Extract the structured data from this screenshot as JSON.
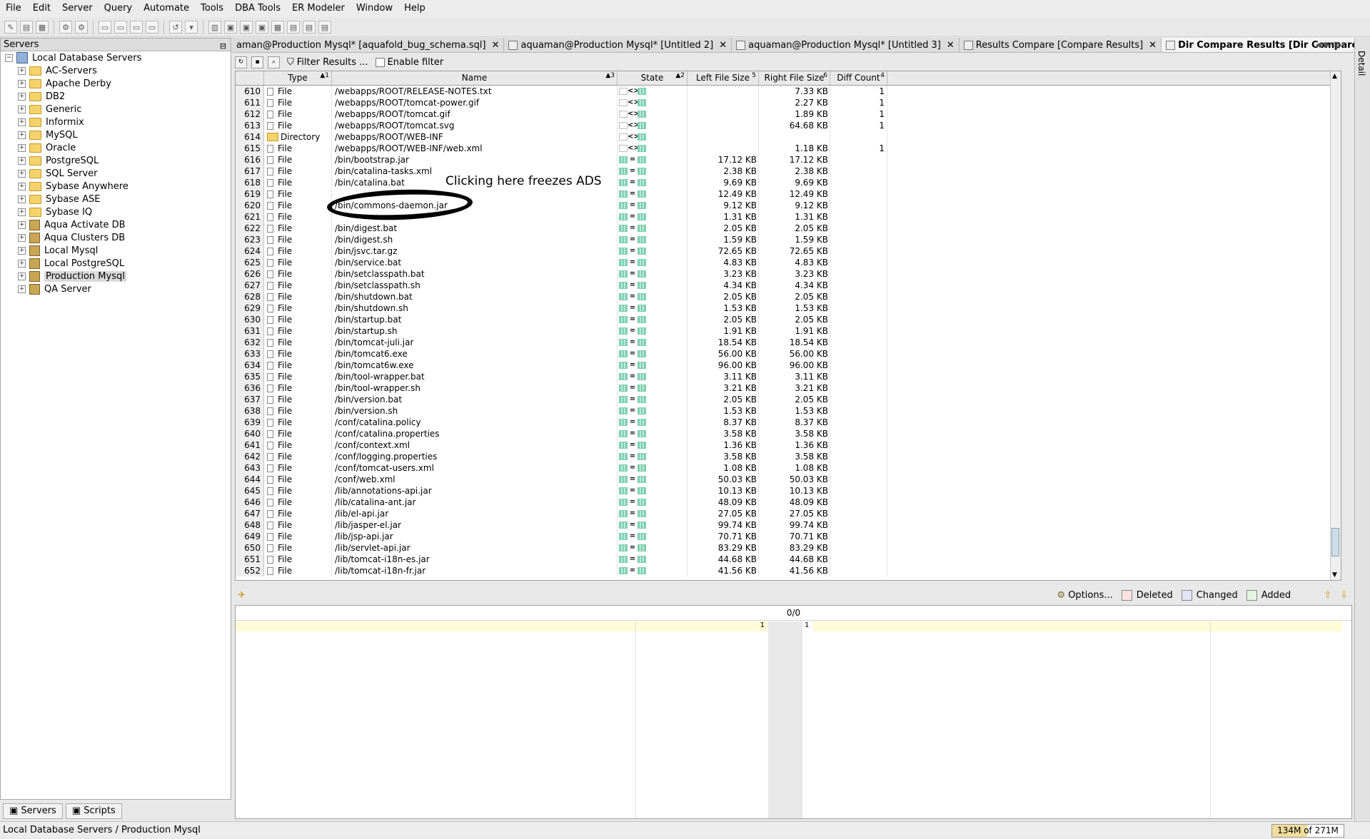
{
  "menu": [
    "File",
    "Edit",
    "Server",
    "Query",
    "Automate",
    "Tools",
    "DBA Tools",
    "ER Modeler",
    "Window",
    "Help"
  ],
  "servers_panel": {
    "title": "Servers",
    "root": "Local Database Servers",
    "items": [
      {
        "label": "AC-Servers",
        "icon": "folder-icon"
      },
      {
        "label": "Apache Derby",
        "icon": "folder-icon"
      },
      {
        "label": "DB2",
        "icon": "folder-icon"
      },
      {
        "label": "Generic",
        "icon": "folder-icon"
      },
      {
        "label": "Informix",
        "icon": "folder-icon"
      },
      {
        "label": "MySQL",
        "icon": "folder-icon"
      },
      {
        "label": "Oracle",
        "icon": "folder-icon"
      },
      {
        "label": "PostgreSQL",
        "icon": "folder-icon"
      },
      {
        "label": "SQL Server",
        "icon": "folder-icon"
      },
      {
        "label": "Sybase Anywhere",
        "icon": "folder-icon"
      },
      {
        "label": "Sybase ASE",
        "icon": "folder-icon"
      },
      {
        "label": "Sybase IQ",
        "icon": "folder-icon"
      },
      {
        "label": "Aqua Activate DB",
        "icon": "database-server-icon"
      },
      {
        "label": "Aqua Clusters DB",
        "icon": "database-server-icon"
      },
      {
        "label": "Local Mysql",
        "icon": "database-server-icon"
      },
      {
        "label": "Local PostgreSQL",
        "icon": "database-server-icon"
      },
      {
        "label": "Production Mysql",
        "icon": "database-server-icon",
        "selected": true
      },
      {
        "label": "QA Server",
        "icon": "database-server-icon"
      }
    ],
    "bottom_tabs": [
      "Servers",
      "Scripts"
    ]
  },
  "doc_tabs": [
    {
      "label": "aman@Production Mysql* [aquafold_bug_schema.sql]",
      "active": false
    },
    {
      "label": "aquaman@Production Mysql* [Untitled 2]",
      "active": false
    },
    {
      "label": "aquaman@Production Mysql* [Untitled 3]",
      "active": false
    },
    {
      "label": "Results Compare [Compare Results]",
      "active": false
    },
    {
      "label": "Dir Compare Results [Dir Compare Results]",
      "active": true
    }
  ],
  "right_strip_label": "Detail",
  "filter_bar": {
    "filter_label": "Filter Results ...",
    "enable_filter_label": "Enable filter"
  },
  "grid": {
    "headers": [
      {
        "label": "",
        "sort": ""
      },
      {
        "label": "Type",
        "sort": "▲1"
      },
      {
        "label": "Name",
        "sort": "▲3"
      },
      {
        "label": "State",
        "sort": "▲2"
      },
      {
        "label": "Left File Size",
        "sort": "5"
      },
      {
        "label": "Right File Size",
        "sort": "6"
      },
      {
        "label": "Diff Count",
        "sort": "4"
      }
    ],
    "rows": [
      [
        "610",
        "File",
        "/webapps/ROOT/RELEASE-NOTES.txt",
        "diff",
        "",
        "7.33 KB",
        "1"
      ],
      [
        "611",
        "File",
        "/webapps/ROOT/tomcat-power.gif",
        "diff",
        "",
        "2.27 KB",
        "1"
      ],
      [
        "612",
        "File",
        "/webapps/ROOT/tomcat.gif",
        "diff",
        "",
        "1.89 KB",
        "1"
      ],
      [
        "613",
        "File",
        "/webapps/ROOT/tomcat.svg",
        "diff",
        "",
        "64.68 KB",
        "1"
      ],
      [
        "614",
        "Directory",
        "/webapps/ROOT/WEB-INF",
        "diff",
        "",
        "",
        ""
      ],
      [
        "615",
        "File",
        "/webapps/ROOT/WEB-INF/web.xml",
        "diff",
        "",
        "1.18 KB",
        "1"
      ],
      [
        "616",
        "File",
        "/bin/bootstrap.jar",
        "same",
        "17.12 KB",
        "17.12 KB",
        ""
      ],
      [
        "617",
        "File",
        "/bin/catalina-tasks.xml",
        "same",
        "2.38 KB",
        "2.38 KB",
        ""
      ],
      [
        "618",
        "File",
        "/bin/catalina.bat",
        "same",
        "9.69 KB",
        "9.69 KB",
        ""
      ],
      [
        "619",
        "File",
        "",
        "same",
        "12.49 KB",
        "12.49 KB",
        ""
      ],
      [
        "620",
        "File",
        "/bin/commons-daemon.jar",
        "same",
        "9.12 KB",
        "9.12 KB",
        ""
      ],
      [
        "621",
        "File",
        "",
        "same",
        "1.31 KB",
        "1.31 KB",
        ""
      ],
      [
        "622",
        "File",
        "/bin/digest.bat",
        "same",
        "2.05 KB",
        "2.05 KB",
        ""
      ],
      [
        "623",
        "File",
        "/bin/digest.sh",
        "same",
        "1.59 KB",
        "1.59 KB",
        ""
      ],
      [
        "624",
        "File",
        "/bin/jsvc.tar.gz",
        "same",
        "72.65 KB",
        "72.65 KB",
        ""
      ],
      [
        "625",
        "File",
        "/bin/service.bat",
        "same",
        "4.83 KB",
        "4.83 KB",
        ""
      ],
      [
        "626",
        "File",
        "/bin/setclasspath.bat",
        "same",
        "3.23 KB",
        "3.23 KB",
        ""
      ],
      [
        "627",
        "File",
        "/bin/setclasspath.sh",
        "same",
        "4.34 KB",
        "4.34 KB",
        ""
      ],
      [
        "628",
        "File",
        "/bin/shutdown.bat",
        "same",
        "2.05 KB",
        "2.05 KB",
        ""
      ],
      [
        "629",
        "File",
        "/bin/shutdown.sh",
        "same",
        "1.53 KB",
        "1.53 KB",
        ""
      ],
      [
        "630",
        "File",
        "/bin/startup.bat",
        "same",
        "2.05 KB",
        "2.05 KB",
        ""
      ],
      [
        "631",
        "File",
        "/bin/startup.sh",
        "same",
        "1.91 KB",
        "1.91 KB",
        ""
      ],
      [
        "632",
        "File",
        "/bin/tomcat-juli.jar",
        "same",
        "18.54 KB",
        "18.54 KB",
        ""
      ],
      [
        "633",
        "File",
        "/bin/tomcat6.exe",
        "same",
        "56.00 KB",
        "56.00 KB",
        ""
      ],
      [
        "634",
        "File",
        "/bin/tomcat6w.exe",
        "same",
        "96.00 KB",
        "96.00 KB",
        ""
      ],
      [
        "635",
        "File",
        "/bin/tool-wrapper.bat",
        "same",
        "3.11 KB",
        "3.11 KB",
        ""
      ],
      [
        "636",
        "File",
        "/bin/tool-wrapper.sh",
        "same",
        "3.21 KB",
        "3.21 KB",
        ""
      ],
      [
        "637",
        "File",
        "/bin/version.bat",
        "same",
        "2.05 KB",
        "2.05 KB",
        ""
      ],
      [
        "638",
        "File",
        "/bin/version.sh",
        "same",
        "1.53 KB",
        "1.53 KB",
        ""
      ],
      [
        "639",
        "File",
        "/conf/catalina.policy",
        "same",
        "8.37 KB",
        "8.37 KB",
        ""
      ],
      [
        "640",
        "File",
        "/conf/catalina.properties",
        "same",
        "3.58 KB",
        "3.58 KB",
        ""
      ],
      [
        "641",
        "File",
        "/conf/context.xml",
        "same",
        "1.36 KB",
        "1.36 KB",
        ""
      ],
      [
        "642",
        "File",
        "/conf/logging.properties",
        "same",
        "3.58 KB",
        "3.58 KB",
        ""
      ],
      [
        "643",
        "File",
        "/conf/tomcat-users.xml",
        "same",
        "1.08 KB",
        "1.08 KB",
        ""
      ],
      [
        "644",
        "File",
        "/conf/web.xml",
        "same",
        "50.03 KB",
        "50.03 KB",
        ""
      ],
      [
        "645",
        "File",
        "/lib/annotations-api.jar",
        "same",
        "10.13 KB",
        "10.13 KB",
        ""
      ],
      [
        "646",
        "File",
        "/lib/catalina-ant.jar",
        "same",
        "48.09 KB",
        "48.09 KB",
        ""
      ],
      [
        "647",
        "File",
        "/lib/el-api.jar",
        "same",
        "27.05 KB",
        "27.05 KB",
        ""
      ],
      [
        "648",
        "File",
        "/lib/jasper-el.jar",
        "same",
        "99.74 KB",
        "99.74 KB",
        ""
      ],
      [
        "649",
        "File",
        "/lib/jsp-api.jar",
        "same",
        "70.71 KB",
        "70.71 KB",
        ""
      ],
      [
        "650",
        "File",
        "/lib/servlet-api.jar",
        "same",
        "83.29 KB",
        "83.29 KB",
        ""
      ],
      [
        "651",
        "File",
        "/lib/tomcat-i18n-es.jar",
        "same",
        "44.68 KB",
        "44.68 KB",
        ""
      ],
      [
        "652",
        "File",
        "/lib/tomcat-i18n-fr.jar",
        "same",
        "41.56 KB",
        "41.56 KB",
        ""
      ]
    ]
  },
  "annotation": {
    "text": "Clicking here freezes ADS"
  },
  "diff_toolbar": {
    "options_label": "Options...",
    "deleted_label": "Deleted",
    "changed_label": "Changed",
    "added_label": "Added",
    "colors": {
      "deleted": "#fde2e2",
      "changed": "#e4e4f8",
      "added": "#e4f5e0"
    }
  },
  "diff_panel": {
    "count": "0/0",
    "left_line": "1",
    "right_line": "1"
  },
  "status": {
    "path": "Local Database Servers / Production Mysql",
    "memory": "134M of 271M",
    "memory_fraction": 0.49
  }
}
